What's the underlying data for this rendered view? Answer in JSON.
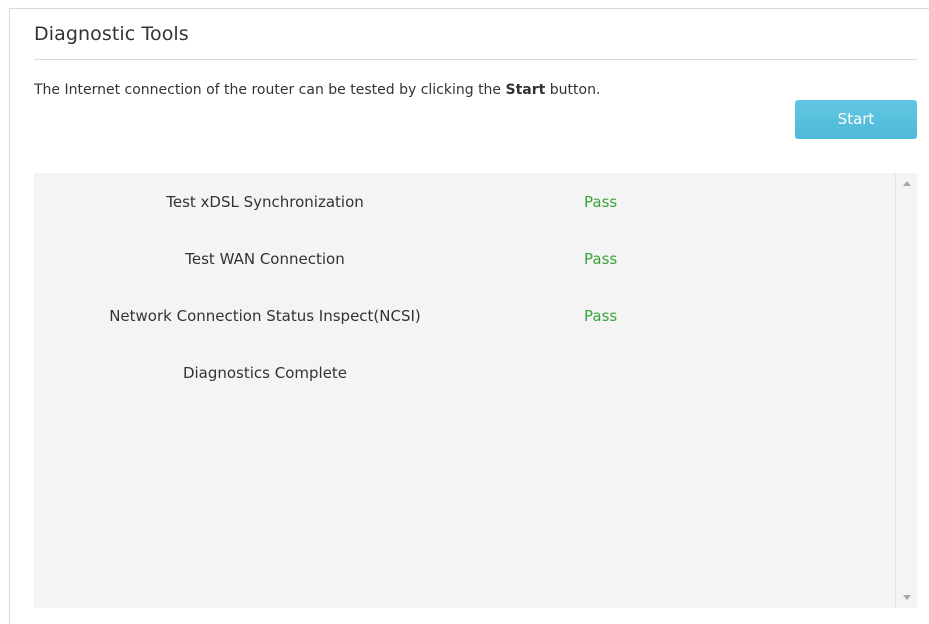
{
  "page": {
    "title": "Diagnostic Tools",
    "description_prefix": "The Internet connection of the router can be tested by clicking the ",
    "description_bold": "Start",
    "description_suffix": " button."
  },
  "actions": {
    "start_label": "Start"
  },
  "results": [
    {
      "name": "Test xDSL Synchronization",
      "status": "Pass"
    },
    {
      "name": "Test WAN Connection",
      "status": "Pass"
    },
    {
      "name": "Network Connection Status Inspect(NCSI)",
      "status": "Pass"
    },
    {
      "name": "Diagnostics Complete",
      "status": ""
    }
  ],
  "colors": {
    "accent": "#5bc0de",
    "pass": "#3aa43a",
    "results_background": "#f4f4f4"
  }
}
